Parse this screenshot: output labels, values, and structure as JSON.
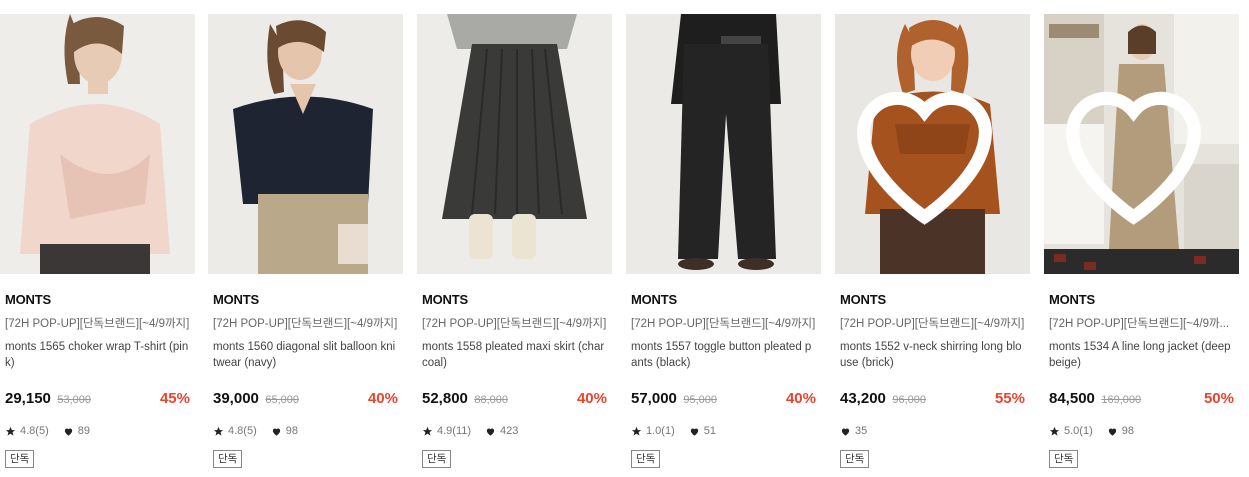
{
  "products": [
    {
      "brand": "MONTS",
      "promo": "[72H POP-UP][단독브랜드][~4/9까지]",
      "title": "monts 1565 choker wrap T-shirt (pink)",
      "price": "29,150",
      "original_price": "53,000",
      "discount": "45%",
      "rating": "4.8(5)",
      "likes": "89",
      "badge": "단독",
      "wish_icon": false
    },
    {
      "brand": "MONTS",
      "promo": "[72H POP-UP][단독브랜드][~4/9까지]",
      "title": "monts 1560 diagonal slit balloon knitwear (navy)",
      "price": "39,000",
      "original_price": "65,000",
      "discount": "40%",
      "rating": "4.8(5)",
      "likes": "98",
      "badge": "단독",
      "wish_icon": false
    },
    {
      "brand": "MONTS",
      "promo": "[72H POP-UP][단독브랜드][~4/9까지]",
      "title": "monts 1558 pleated maxi skirt (charcoal)",
      "price": "52,800",
      "original_price": "88,000",
      "discount": "40%",
      "rating": "4.9(11)",
      "likes": "423",
      "badge": "단독",
      "wish_icon": false
    },
    {
      "brand": "MONTS",
      "promo": "[72H POP-UP][단독브랜드][~4/9까지]",
      "title": "monts 1557 toggle button pleated pants (black)",
      "price": "57,000",
      "original_price": "95,000",
      "discount": "40%",
      "rating": "1.0(1)",
      "likes": "51",
      "badge": "단독",
      "wish_icon": false
    },
    {
      "brand": "MONTS",
      "promo": "[72H POP-UP][단독브랜드][~4/9까지]",
      "title": "monts 1552 v-neck shirring long blouse (brick)",
      "price": "43,200",
      "original_price": "96,000",
      "discount": "55%",
      "rating": "",
      "likes": "35",
      "badge": "단독",
      "wish_icon": true
    },
    {
      "brand": "MONTS",
      "promo": "[72H POP-UP][단독브랜드][~4/9까...",
      "title": "monts 1534 A line long jacket (deep beige)",
      "price": "84,500",
      "original_price": "169,000",
      "discount": "50%",
      "rating": "5.0(1)",
      "likes": "98",
      "badge": "단독",
      "wish_icon": true
    }
  ],
  "colors": {
    "discount": "#e8452e",
    "image_bg": "#eeece8"
  }
}
